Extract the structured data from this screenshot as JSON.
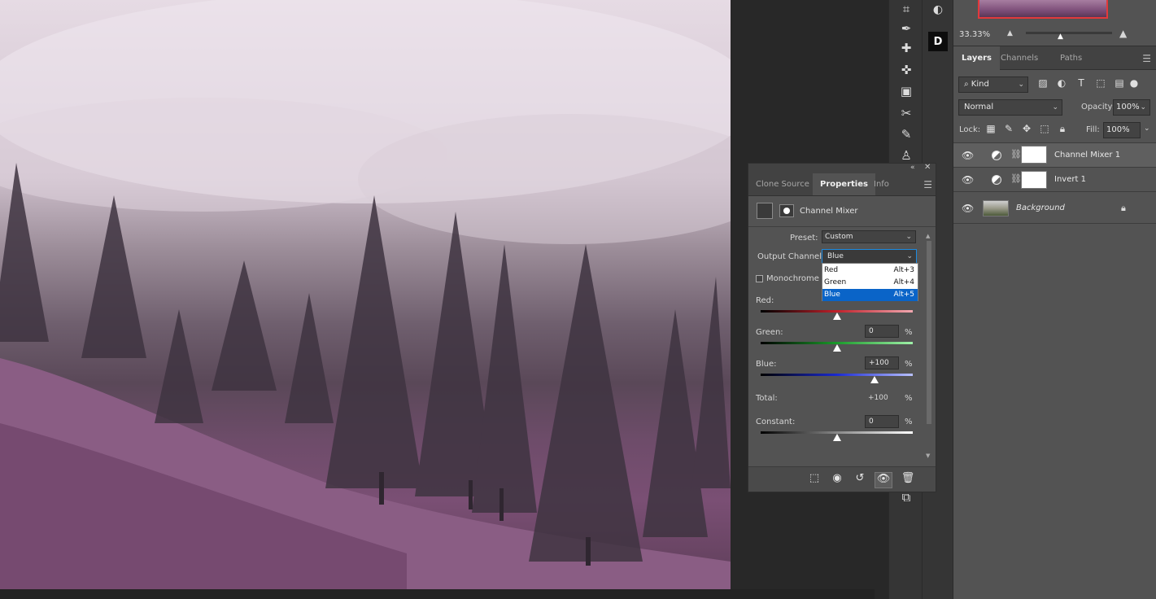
{
  "navigator": {
    "zoom": "33.33%"
  },
  "layers_panel": {
    "tabs": [
      "Layers",
      "Channels",
      "Paths"
    ],
    "filter_kind": "Kind",
    "blend_mode": "Normal",
    "opacity_label": "Opacity:",
    "opacity_value": "100%",
    "lock_label": "Lock:",
    "fill_label": "Fill:",
    "fill_value": "100%",
    "layers": [
      {
        "name": "Channel Mixer 1",
        "selected": true
      },
      {
        "name": "Invert 1",
        "selected": false
      },
      {
        "name": "Background",
        "selected": false
      }
    ]
  },
  "properties_panel": {
    "tabs": [
      "Clone Source",
      "Properties",
      "Info"
    ],
    "adjustment_title": "Channel Mixer",
    "preset_label": "Preset:",
    "preset_value": "Custom",
    "output_channel_label": "Output Channel:",
    "output_channel_value": "Blue",
    "monochrome_label": "Monochrome",
    "red_label": "Red:",
    "green_label": "Green:",
    "green_value": "0",
    "blue_label": "Blue:",
    "blue_value": "+100",
    "total_label": "Total:",
    "total_value": "+100",
    "constant_label": "Constant:",
    "constant_value": "0",
    "percent": "%",
    "red_slider_level": 0.5,
    "green_slider_level": 0.5,
    "blue_slider_level": 0.75,
    "constant_slider_level": 0.5,
    "dropdown_options": [
      {
        "label": "Red",
        "shortcut": "Alt+3"
      },
      {
        "label": "Green",
        "shortcut": "Alt+4"
      },
      {
        "label": "Blue",
        "shortcut": "Alt+5",
        "selected": true
      }
    ]
  },
  "colors": {
    "accent_selected": "#0a64c8",
    "navigator_frame": "#e2393b",
    "panel_bg": "#535353"
  }
}
